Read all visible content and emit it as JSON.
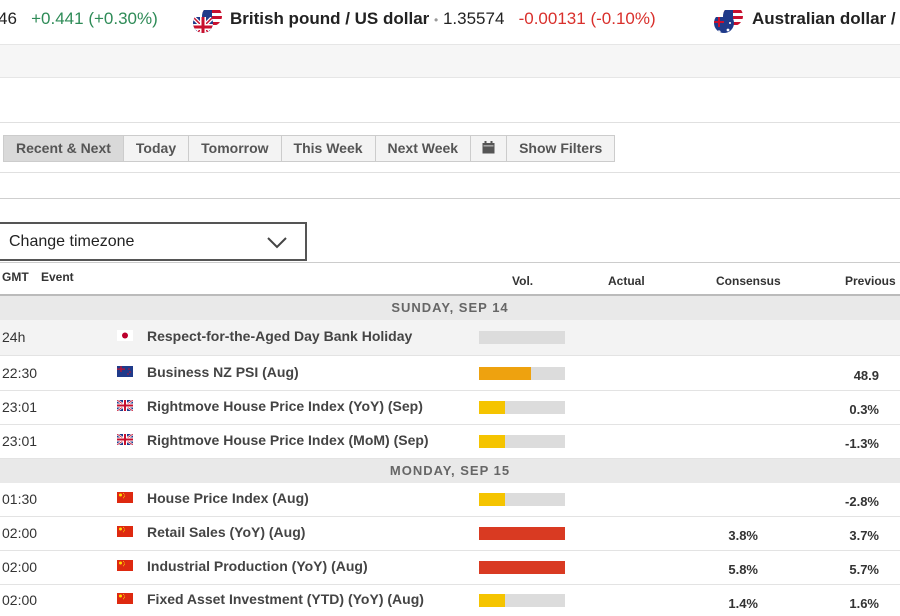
{
  "ticker": [
    {
      "price_tail": "46",
      "change": "+0.441",
      "change_pct": "(+0.30%)",
      "direction": "up"
    },
    {
      "pair": "British pound / US dollar",
      "flags": [
        "gb-flag-icon",
        "us-flag-icon"
      ],
      "price": "1.35574",
      "change": "-0.00131",
      "change_pct": "(-0.10%)",
      "direction": "down"
    },
    {
      "pair": "Australian dollar / US dollar",
      "flags": [
        "au-flag-icon",
        "us-flag-icon"
      ]
    }
  ],
  "tabs": [
    {
      "label": "Recent & Next",
      "active": true
    },
    {
      "label": "Today"
    },
    {
      "label": "Tomorrow"
    },
    {
      "label": "This Week"
    },
    {
      "label": "Next Week"
    },
    {
      "label": "",
      "icon": "calendar-icon"
    },
    {
      "label": "Show Filters"
    }
  ],
  "timezone": {
    "label": "Change timezone",
    "icon": "chevron-down-icon"
  },
  "columns": {
    "gmt": "GMT",
    "event": "Event",
    "vol": "Vol.",
    "actual": "Actual",
    "consensus": "Consensus",
    "previous": "Previous"
  },
  "colors": {
    "vol_low": "#f5c400",
    "vol_medium": "#eea20f",
    "vol_high": "#d93a22",
    "positive": "#2e8b57",
    "negative": "#d9302c"
  },
  "days": [
    {
      "date": "SUNDAY, SEP 14",
      "events": [
        {
          "time": "24h",
          "country": "jp-flag-icon",
          "event": "Respect-for-the-Aged Day Bank Holiday",
          "volatility": 0,
          "actual": "",
          "consensus": "",
          "previous": "",
          "holiday": true
        },
        {
          "time": "22:30",
          "country": "nz-flag-icon",
          "event": "Business NZ PSI (Aug)",
          "volatility": 0.6,
          "level": "medium",
          "actual": "",
          "consensus": "",
          "previous": "48.9"
        },
        {
          "time": "23:01",
          "country": "gb-flag-icon",
          "event": "Rightmove House Price Index (YoY) (Sep)",
          "volatility": 0.3,
          "level": "low",
          "actual": "",
          "consensus": "",
          "previous": "0.3%"
        },
        {
          "time": "23:01",
          "country": "gb-flag-icon",
          "event": "Rightmove House Price Index (MoM) (Sep)",
          "volatility": 0.3,
          "level": "low",
          "actual": "",
          "consensus": "",
          "previous": "-1.3%"
        }
      ]
    },
    {
      "date": "MONDAY, SEP 15",
      "events": [
        {
          "time": "01:30",
          "country": "cn-flag-icon",
          "event": "House Price Index (Aug)",
          "volatility": 0.3,
          "level": "low",
          "actual": "",
          "consensus": "",
          "previous": "-2.8%"
        },
        {
          "time": "02:00",
          "country": "cn-flag-icon",
          "event": "Retail Sales (YoY) (Aug)",
          "volatility": 1.0,
          "level": "high",
          "actual": "",
          "consensus": "3.8%",
          "previous": "3.7%"
        },
        {
          "time": "02:00",
          "country": "cn-flag-icon",
          "event": "Industrial Production (YoY) (Aug)",
          "volatility": 1.0,
          "level": "high",
          "actual": "",
          "consensus": "5.8%",
          "previous": "5.7%"
        },
        {
          "time": "02:00",
          "country": "cn-flag-icon",
          "event": "Fixed Asset Investment (YTD) (YoY) (Aug)",
          "volatility": 0.3,
          "level": "low",
          "actual": "",
          "consensus": "1.4%",
          "previous": "1.6%"
        }
      ]
    }
  ]
}
